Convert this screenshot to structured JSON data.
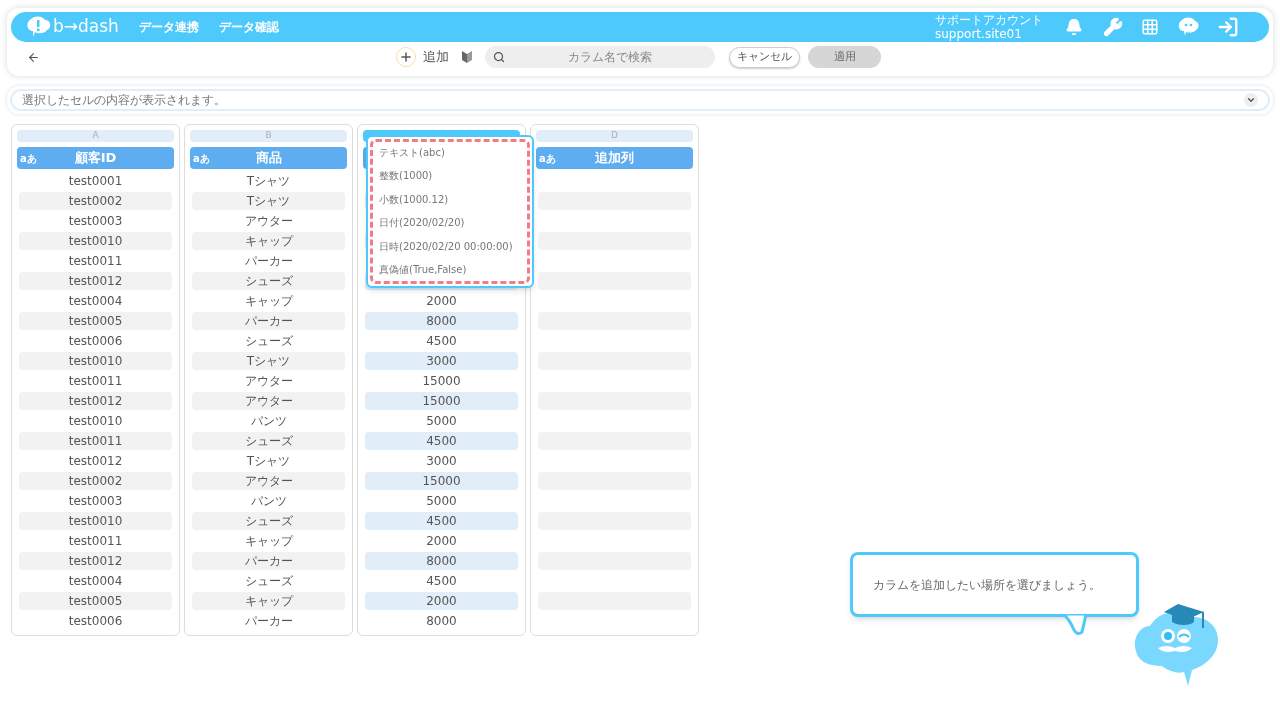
{
  "brand": {
    "name": "b→dash"
  },
  "nav": [
    {
      "label": "データ連携"
    },
    {
      "label": "データ確認"
    }
  ],
  "account": {
    "name": "サポートアカウント",
    "id": "support.site01"
  },
  "toolbar": {
    "add_label": "追加",
    "search": {
      "placeholder": "カラム名で検索"
    },
    "cancel": "キャンセル",
    "apply": {
      "label": "適用",
      "disabled": true
    }
  },
  "cell_display": {
    "placeholder": "選択したセルの内容が表示されます。"
  },
  "columns": [
    {
      "letter": "A",
      "type_badge": "aあ",
      "title": "顧客ID",
      "selected": false,
      "cells": [
        "test0001",
        "test0002",
        "test0003",
        "test0010",
        "test0011",
        "test0012",
        "test0004",
        "test0005",
        "test0006",
        "test0010",
        "test0011",
        "test0012",
        "test0010",
        "test0011",
        "test0012",
        "test0002",
        "test0003",
        "test0010",
        "test0011",
        "test0012",
        "test0004",
        "test0005",
        "test0006"
      ]
    },
    {
      "letter": "B",
      "type_badge": "aあ",
      "title": "商品",
      "selected": false,
      "cells": [
        "Tシャツ",
        "Tシャツ",
        "アウター",
        "キャップ",
        "パーカー",
        "シューズ",
        "キャップ",
        "パーカー",
        "シューズ",
        "Tシャツ",
        "アウター",
        "アウター",
        "パンツ",
        "シューズ",
        "Tシャツ",
        "アウター",
        "パンツ",
        "シューズ",
        "キャップ",
        "パーカー",
        "シューズ",
        "キャップ",
        "パーカー"
      ]
    },
    {
      "selected": true,
      "cells": [
        "2000",
        "8000",
        "4500",
        "3000",
        "15000",
        "15000",
        "5000",
        "4500",
        "3000",
        "15000",
        "5000",
        "4500",
        "2000",
        "8000",
        "4500",
        "2000",
        "8000"
      ]
    },
    {
      "letter": "D",
      "type_badge": "aあ",
      "title": "追加列",
      "selected": false
    }
  ],
  "type_menu": [
    {
      "label": "テキスト(abc)"
    },
    {
      "label": "整数(1000)"
    },
    {
      "label": "小数(1000.12)"
    },
    {
      "label": "日付(2020/02/20)"
    },
    {
      "label": "日時(2020/02/20 00:00:00)"
    },
    {
      "label": "真偽値(True,False)"
    }
  ],
  "hint": {
    "message": "カラムを追加したい場所を選びましょう。"
  }
}
